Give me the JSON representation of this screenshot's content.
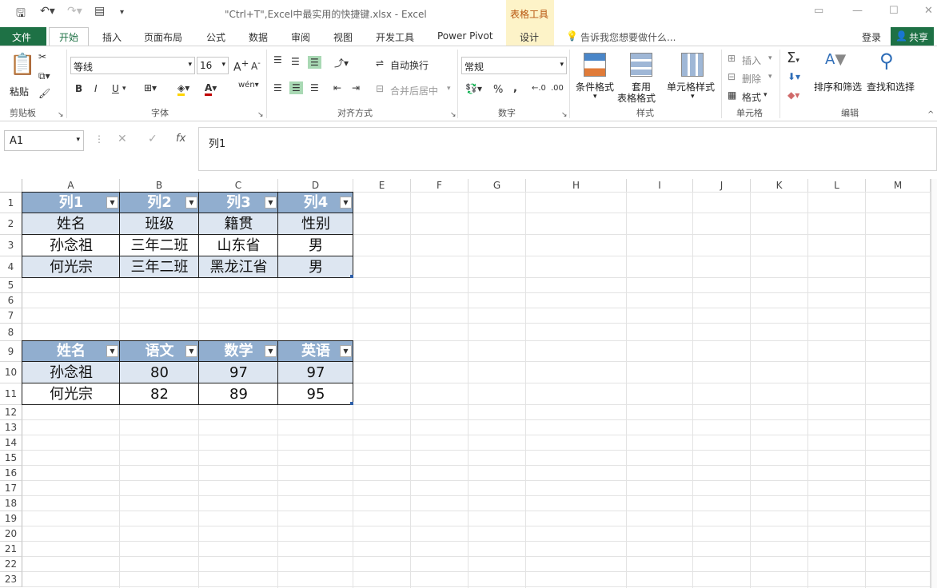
{
  "window": {
    "title": "\"Ctrl+T\",Excel中最实用的快捷键.xlsx - Excel",
    "context_tab_group": "表格工具"
  },
  "tabs": [
    "文件",
    "开始",
    "插入",
    "页面布局",
    "公式",
    "数据",
    "审阅",
    "视图",
    "开发工具",
    "Power Pivot",
    "设计"
  ],
  "tell_me": "告诉我您想要做什么...",
  "login": "登录",
  "share": "共享",
  "ribbon": {
    "clipboard": {
      "paste": "粘贴",
      "group": "剪贴板"
    },
    "font": {
      "name": "等线",
      "size": "16",
      "bold": "B",
      "italic": "I",
      "underline": "U",
      "group": "字体"
    },
    "alignment": {
      "wrap": "自动换行",
      "merge": "合并后居中",
      "group": "对齐方式"
    },
    "number": {
      "format": "常规",
      "percent": "%",
      "comma": ",",
      "group": "数字"
    },
    "styles": {
      "conditional": "条件格式",
      "table1": "套用",
      "table2": "表格格式",
      "cell_styles": "单元格样式",
      "group": "样式"
    },
    "cells": {
      "insert": "插入",
      "delete": "删除",
      "format": "格式",
      "group": "单元格"
    },
    "editing": {
      "sort": "排序和筛选",
      "find": "查找和选择",
      "group": "编辑"
    }
  },
  "formula_bar": {
    "name_box": "A1",
    "fx": "fx",
    "content": "列1"
  },
  "columns": [
    "A",
    "B",
    "C",
    "D",
    "E",
    "F",
    "G",
    "H",
    "I",
    "J",
    "K",
    "L",
    "M"
  ],
  "rows": [
    "1",
    "2",
    "3",
    "4",
    "5",
    "6",
    "7",
    "8",
    "9",
    "10",
    "11",
    "12",
    "13",
    "14",
    "15",
    "16",
    "17",
    "18",
    "19",
    "20",
    "21",
    "22",
    "23"
  ],
  "table1": {
    "headers": [
      "列1",
      "列2",
      "列3",
      "列4"
    ],
    "rows": [
      [
        "姓名",
        "班级",
        "籍贯",
        "性别"
      ],
      [
        "孙念祖",
        "三年二班",
        "山东省",
        "男"
      ],
      [
        "何光宗",
        "三年二班",
        "黑龙江省",
        "男"
      ]
    ]
  },
  "table2": {
    "headers": [
      "姓名",
      "语文",
      "数学",
      "英语"
    ],
    "rows": [
      [
        "孙念祖",
        "80",
        "97",
        "97"
      ],
      [
        "何光宗",
        "82",
        "89",
        "95"
      ]
    ]
  },
  "colors": {
    "excel_green": "#1e7145",
    "table_header": "#91aecf",
    "table_band": "#dde6f1",
    "context_tab": "#fdf3c8"
  }
}
